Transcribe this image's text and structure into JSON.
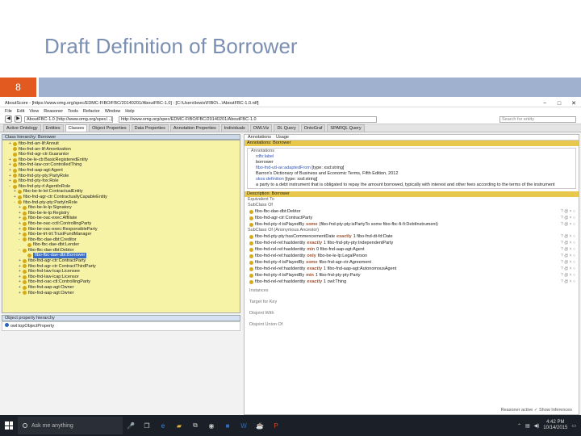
{
  "slide": {
    "title": "Draft Definition of Borrower",
    "number": "8"
  },
  "window": {
    "title": "AboutScore - [https://www.omg.org/spec/EDMC-FIBO/FBC/20140201/AboutFBC-1.0] : [C:\\Users\\lewis\\FIBO\\...\\AboutFBC-1.0.rdf]",
    "menu": [
      "File",
      "Edit",
      "View",
      "Reasoner",
      "Tools",
      "Refactor",
      "Window",
      "Help"
    ],
    "ontology_select": "AboutFBC-1.0 (http://www.omg.org/spec/...)",
    "url": "http://www.omg.org/spec/EDMC-FIBO/FBC/20140201/AboutFBC-1.0",
    "search_placeholder": "Search for entity",
    "tabs": [
      "Active Ontology",
      "Entities",
      "Classes",
      "Object Properties",
      "Data Properties",
      "Annotation Properties",
      "Individuals",
      "OWLViz",
      "DL Query",
      "OntoGraf",
      "SPARQL Query"
    ]
  },
  "left": {
    "header": "Class hierarchy: Borrower",
    "items": [
      {
        "label": "fibo-fnd-arr-lif:Annuit",
        "exp": "+",
        "indent": 1
      },
      {
        "label": "fibo-fnd-arr-lif:Amortization",
        "exp": "",
        "indent": 1
      },
      {
        "label": "fibo-fnd-agr-ctr:Guarantor",
        "exp": "",
        "indent": 1
      },
      {
        "label": "fibo-be-le-cb:BasicRegisteredEntity",
        "exp": "+",
        "indent": 1
      },
      {
        "label": "fibo-fnd-law-cor:ControlledThing",
        "exp": "+",
        "indent": 1
      },
      {
        "label": "fibo-fnd-aap-agt:Agent",
        "exp": "+",
        "indent": 1
      },
      {
        "label": "fibo-fnd-pty-pty:PartyRole",
        "exp": "+",
        "indent": 1
      },
      {
        "label": "fibo-fnd-pty-fox:Role",
        "exp": "+",
        "indent": 1
      },
      {
        "label": "fibo-fnd-pty-rl:AgentInRole",
        "exp": "-",
        "indent": 1
      },
      {
        "label": "fibo-be-le-lei:ContractualEntity",
        "exp": "+",
        "indent": 2
      },
      {
        "label": "fibo-fnd-agr-ctr:ContractuallyCapableEntity",
        "exp": "+",
        "indent": 2
      },
      {
        "label": "fibo-fnd-pty-pty:PartyInRole",
        "exp": "-",
        "indent": 2
      },
      {
        "label": "fibo-be-le-lp:Signatory",
        "exp": "+",
        "indent": 3
      },
      {
        "label": "fibo-be-le-lp:Registry",
        "exp": "+",
        "indent": 3
      },
      {
        "label": "fibo-be-oac-exec:Affiliate",
        "exp": "+",
        "indent": 3
      },
      {
        "label": "fibo-be-oac-cctl:ControllingParty",
        "exp": "+",
        "indent": 3
      },
      {
        "label": "fibo-be-oac-exec:ResponsibleParty",
        "exp": "+",
        "indent": 3
      },
      {
        "label": "fibo-be-trt-trt:TrustFundManager",
        "exp": "+",
        "indent": 3
      },
      {
        "label": "fibo-fbc-dae-dbt:Creditor",
        "exp": "-",
        "indent": 3
      },
      {
        "label": "fibo-fbc-dae-dbt:Lender",
        "exp": "",
        "indent": 4
      },
      {
        "label": "fibo-fbc-dae-dbt:Debtor",
        "exp": "-",
        "indent": 3
      },
      {
        "label": "fibo-fbc-dae-dbt:Borrower",
        "exp": "",
        "indent": 4,
        "selected": true
      },
      {
        "label": "fibo-fnd-agr-ctr:ContractParty",
        "exp": "+",
        "indent": 3
      },
      {
        "label": "fibo-fnd-agr-ctr:ContractThirdParty",
        "exp": "+",
        "indent": 3
      },
      {
        "label": "fibo-fnd-law-lcap:Licensee",
        "exp": "+",
        "indent": 3
      },
      {
        "label": "fibo-fnd-law-lcap:Licensor",
        "exp": "+",
        "indent": 3
      },
      {
        "label": "fibo-fnd-oac-ctl:ControllingParty",
        "exp": "+",
        "indent": 3
      },
      {
        "label": "fibo-fnd-aap-agt:Owner",
        "exp": "+",
        "indent": 3
      },
      {
        "label": "fibo-fnd-aap-agt:Owner",
        "exp": "+",
        "indent": 3
      }
    ],
    "objprop_header": "Object property hierarchy",
    "objprop_item": "owl:topObjectProperty"
  },
  "right": {
    "tabs": [
      "Annotations",
      "Usage"
    ],
    "header": "Annotations: Borrower",
    "annot_header": "Annotations",
    "annotations": [
      {
        "k": "rdfs:label",
        "v": ""
      },
      {
        "k": "",
        "v": "borrower"
      },
      {
        "k": "fibo-fnd-utl-av:adaptedFrom",
        "v": "[type: xsd:string]"
      },
      {
        "k": "",
        "v": "Barron's Dictionary of Business and Economic Terms, Fifth Edition, 2012"
      },
      {
        "k": "skos:definition",
        "v": "[type: xsd:string]"
      },
      {
        "k": "",
        "v": "a party to a debt instrument that is obligated to repay the amount borrowed, typically with interest and other fees according to the terms of the instrument"
      }
    ],
    "desc_header": "Description: Borrower",
    "equiv": "Equivalent To",
    "subclass_header": "SubClass Of",
    "subclass": [
      {
        "text": "fibo-fbc-dae-dbt:Debtor",
        "kw": "",
        "rest": ""
      },
      {
        "text": "fibo-fnd-agr-ctr:ContractParty",
        "kw": "",
        "rest": ""
      },
      {
        "text": "fibo-fnd-pty-rl:isPlayedBy",
        "kw": "some",
        "rest": "(fibo-fnd-pty-pty:isPartyTo some fibo-fbc-fi-fi:DebtInstrument)"
      }
    ],
    "inherited_header": "SubClass Of (Anonymous Ancestor)",
    "inherited": [
      {
        "text": "fibo-fnd-pty-pty:hasCommencementDate",
        "kw": "exactly",
        "rest": "1 fibo-fnd-dt-fd:Date"
      },
      {
        "text": "fibo-fnd-rel-rel:hasIdentity",
        "kw": "exactly",
        "rest": "1 fibo-fnd-pty-pty:IndependentParty"
      },
      {
        "text": "fibo-fnd-rel-rel:hasIdentity",
        "kw": "min",
        "rest": "0 fibo-fnd-aap-agt:Agent"
      },
      {
        "text": "fibo-fnd-rel-rel:hasIdentity",
        "kw": "only",
        "rest": "fibo-be-le-lp:LegalPerson"
      },
      {
        "text": "fibo-fnd-pty-rl:isPlayedBy",
        "kw": "some",
        "rest": "fibo-fnd-agr-ctr:Agreement"
      },
      {
        "text": "fibo-fnd-rel-rel:hasIdentity",
        "kw": "exactly",
        "rest": "1 fibo-fnd-aap-agt:AutonomousAgent"
      },
      {
        "text": "fibo-fnd-pty-rl:isPlayedBy",
        "kw": "min",
        "rest": "1 fibo-fnd-pty-pty:Party"
      },
      {
        "text": "fibo-fnd-rel-rel:hasIdentity",
        "kw": "exactly",
        "rest": "1 owl:Thing"
      }
    ],
    "members": [
      "Instances",
      "Target for Key",
      "Disjoint With",
      "Disjoint Union Of"
    ],
    "reasoner": "Reasoner active   ✓ Show Inferences"
  },
  "taskbar": {
    "search": "Ask me anything",
    "time": "4:42 PM",
    "date": "10/14/2015"
  }
}
